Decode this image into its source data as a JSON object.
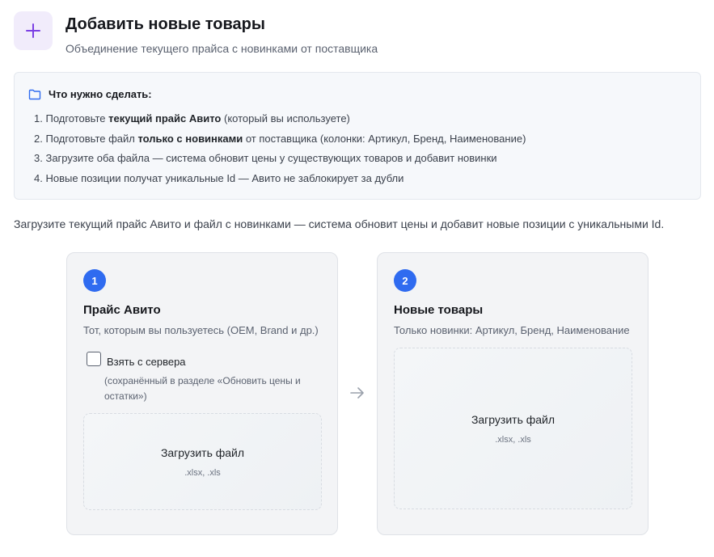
{
  "header": {
    "title": "Добавить новые товары",
    "subtitle": "Объединение текущего прайса с новинками от поставщика",
    "icon": "plus-icon"
  },
  "info": {
    "title": "Что нужно сделать:",
    "icon": "folder-icon",
    "steps": [
      {
        "num": "1.",
        "a": "Подготовьте ",
        "b": "текущий прайс Авито",
        "c": " (который вы используете)"
      },
      {
        "num": "2.",
        "a": "Подготовьте файл ",
        "b": "только с новинками",
        "c": " от поставщика (колонки: Артикул, Бренд, Наименование)"
      },
      {
        "num": "3.",
        "a": "Загрузите оба файла — система обновит цены у существующих товаров и добавит новинки",
        "b": "",
        "c": ""
      },
      {
        "num": "4.",
        "a": "Новые позиции получат уникальные Id — Авито не заблокирует за дубли",
        "b": "",
        "c": ""
      }
    ]
  },
  "lead": "Загрузите текущий прайс Авито и файл с новинками — система обновит цены и добавит новые позиции с уникальными Id.",
  "cards": [
    {
      "badge": "1",
      "title": "Прайс Авито",
      "subtitle": "Тот, которым вы пользуетесь (OEM, Brand и др.)",
      "checkbox_label": "Взять с сервера",
      "checkbox_checked": false,
      "checkbox_note": "(сохранённый в разделе «Обновить цены и остатки»)",
      "upload_label": "Загрузить файл",
      "upload_hint": ".xlsx, .xls"
    },
    {
      "badge": "2",
      "title": "Новые товары",
      "subtitle": "Только новинки: Артикул, Бренд, Наименование",
      "upload_label": "Загрузить файл",
      "upload_hint": ".xlsx, .xls"
    }
  ],
  "arrow_icon": "arrow-right-icon",
  "colors": {
    "accent": "#2f6bf0",
    "plus": "#7b3fe4",
    "plus_bg": "#f1ecfb"
  }
}
